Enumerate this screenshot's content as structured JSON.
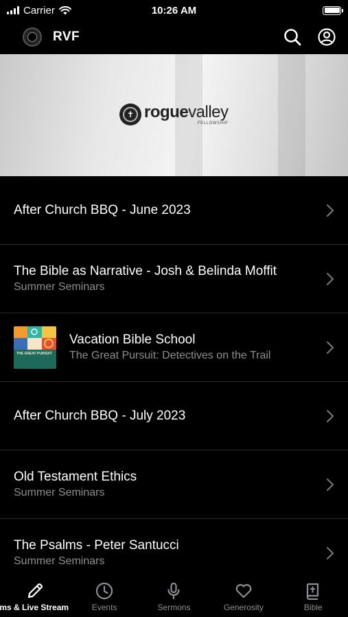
{
  "status": {
    "carrier": "Carrier",
    "time": "10:26 AM"
  },
  "header": {
    "title": "RVF",
    "icons": [
      "search-icon",
      "account-icon"
    ]
  },
  "banner": {
    "brand_bold": "rogue",
    "brand_rest": "valley",
    "brand_sub": "FELLOWSHIP"
  },
  "items": [
    {
      "title": "After Church BBQ - June 2023",
      "subtitle": ""
    },
    {
      "title": "The Bible as Narrative - Josh & Belinda Moffit",
      "subtitle": "Summer Seminars"
    },
    {
      "title": "Vacation Bible School",
      "subtitle": "The Great Pursuit: Detectives on the Trail",
      "thumb_caption": "THE GREAT PURSUIT"
    },
    {
      "title": "After Church BBQ - July 2023",
      "subtitle": ""
    },
    {
      "title": "Old Testament Ethics",
      "subtitle": "Summer Seminars"
    },
    {
      "title": "The Psalms - Peter Santucci",
      "subtitle": "Summer Seminars"
    }
  ],
  "tabs": [
    {
      "label": "orms & Live Stream",
      "icon": "pencil-icon",
      "active": true
    },
    {
      "label": "Events",
      "icon": "clock-icon",
      "active": false
    },
    {
      "label": "Sermons",
      "icon": "microphone-icon",
      "active": false
    },
    {
      "label": "Generosity",
      "icon": "heart-icon",
      "active": false
    },
    {
      "label": "Bible",
      "icon": "bible-icon",
      "active": false
    }
  ],
  "colors": {
    "background": "#000000",
    "text": "#ffffff",
    "secondary_text": "#8e8e93",
    "divider": "#2a2a2a"
  }
}
